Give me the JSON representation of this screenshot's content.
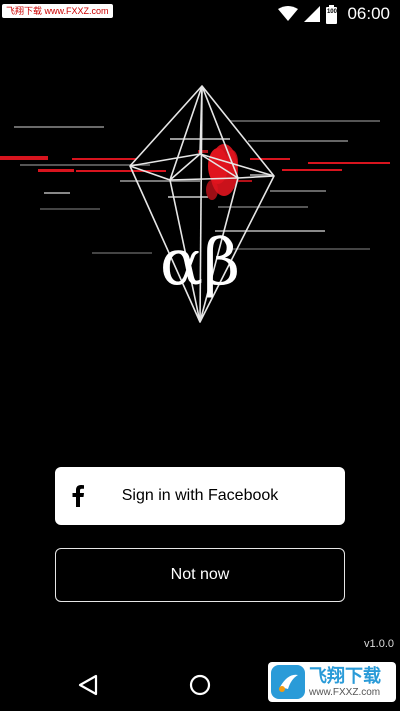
{
  "status_bar": {
    "watermark": "飞翔下载 www.FXXZ.com",
    "time": "06:00",
    "battery_level": "100"
  },
  "hero": {
    "logo_text": "αβ"
  },
  "buttons": {
    "facebook_label": "Sign in with Facebook",
    "not_now_label": "Not now"
  },
  "footer": {
    "version": "v1.0.0"
  },
  "watermark_bottom": {
    "title": "飞翔下载",
    "url": "www.FXXZ.com"
  },
  "colors": {
    "background": "#000000",
    "button_primary_bg": "#ffffff",
    "accent_red": "#e0141e"
  },
  "icons": {
    "wifi": "wifi-icon",
    "signal": "cell-signal-icon",
    "battery": "battery-icon",
    "facebook": "facebook-icon",
    "back": "back-icon",
    "home": "home-icon"
  }
}
